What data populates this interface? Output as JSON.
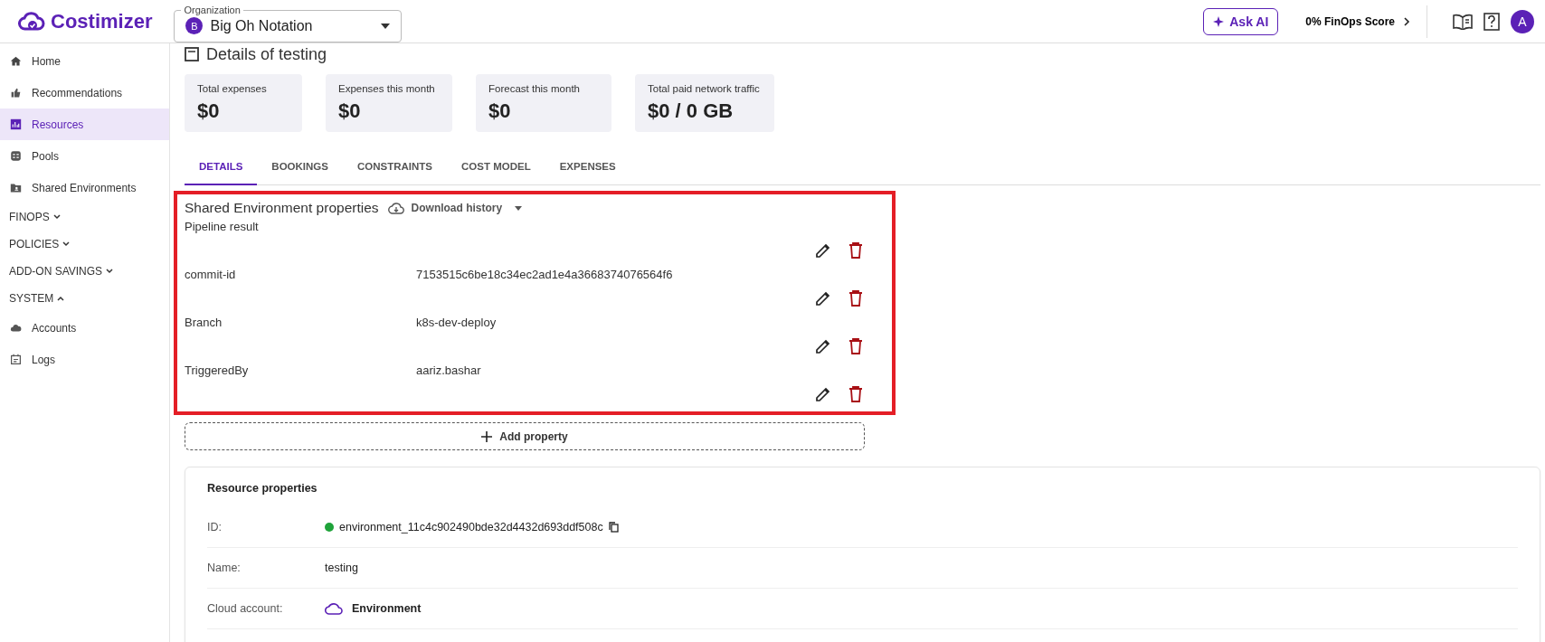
{
  "header": {
    "logo": "Costimizer",
    "org_label": "Organization",
    "org_avatar": "B",
    "org_name": "Big Oh Notation",
    "ask_ai": "Ask AI",
    "finops_score": "0% FinOps Score",
    "user_avatar": "A"
  },
  "sidebar": {
    "items": [
      {
        "kind": "link",
        "label": "Home",
        "selected": false
      },
      {
        "kind": "link",
        "label": "Recommendations",
        "selected": false
      },
      {
        "kind": "link",
        "label": "Resources",
        "selected": true
      },
      {
        "kind": "link",
        "label": "Pools",
        "selected": false
      },
      {
        "kind": "link",
        "label": "Shared Environments",
        "selected": false
      },
      {
        "kind": "group",
        "label": "FINOPS",
        "expanded": false
      },
      {
        "kind": "group",
        "label": "POLICIES",
        "expanded": false
      },
      {
        "kind": "group",
        "label": "ADD-ON SAVINGS",
        "expanded": false
      },
      {
        "kind": "group",
        "label": "SYSTEM",
        "expanded": true
      },
      {
        "kind": "link",
        "label": "Accounts",
        "selected": false
      },
      {
        "kind": "link",
        "label": "Logs",
        "selected": false
      }
    ]
  },
  "page": {
    "title": "Details of testing"
  },
  "stats": [
    {
      "label": "Total expenses",
      "value": "$0"
    },
    {
      "label": "Expenses this month",
      "value": "$0"
    },
    {
      "label": "Forecast this month",
      "value": "$0"
    },
    {
      "label": "Total paid network traffic",
      "value": "$0 / 0 GB"
    }
  ],
  "tabs": [
    {
      "label": "DETAILS",
      "selected": true
    },
    {
      "label": "BOOKINGS",
      "selected": false
    },
    {
      "label": "CONSTRAINTS",
      "selected": false
    },
    {
      "label": "COST MODEL",
      "selected": false
    },
    {
      "label": "EXPENSES",
      "selected": false
    }
  ],
  "shared_properties": {
    "title": "Shared Environment properties",
    "download": "Download history",
    "rows": [
      {
        "key": "Pipeline result",
        "value": ""
      },
      {
        "key": "commit-id",
        "value": "7153515c6be18c34ec2ad1e4a3668374076564f6"
      },
      {
        "key": "Branch",
        "value": "k8s-dev-deploy"
      },
      {
        "key": "TriggeredBy",
        "value": "aariz.bashar"
      }
    ],
    "add": "Add property"
  },
  "resource_properties": {
    "title": "Resource properties",
    "rows": [
      {
        "kind": "id",
        "label": "ID:",
        "value": "environment_11c4c902490bde32d4432d693ddf508c",
        "color": "#1fa33a"
      },
      {
        "kind": "text",
        "label": "Name:",
        "value": "testing"
      },
      {
        "kind": "cloud",
        "label": "Cloud account:",
        "value": "Environment"
      }
    ]
  }
}
